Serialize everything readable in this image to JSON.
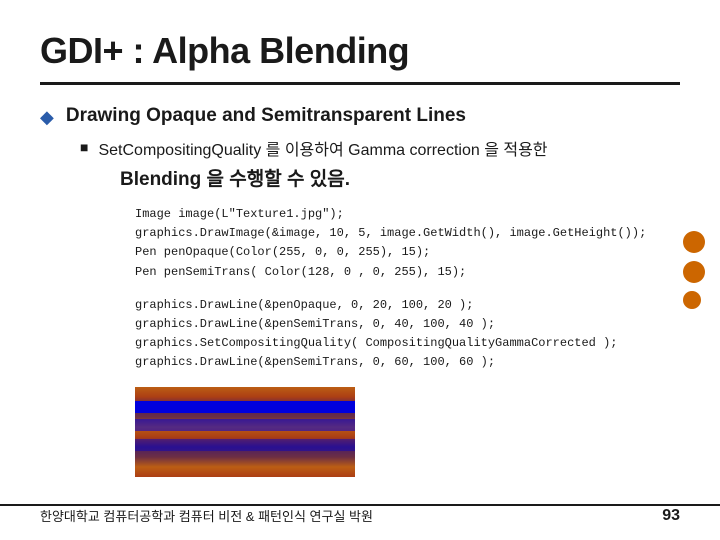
{
  "title": "GDI+ : Alpha Blending",
  "divider": true,
  "main_bullet": {
    "icon": "◆",
    "text": "Drawing Opaque and Semitransparent Lines"
  },
  "sub_bullet": {
    "icon": "■",
    "text_part1": "SetCompositingQuality 를 이용하여 Gamma",
    "text_correction": "correction",
    "text_part2": "을 적용한"
  },
  "blending_text": "Blending 을 수행할 수 있음.",
  "code_block1": [
    "Image image(L\"Texture1.jpg\");",
    "graphics.DrawImage(&image, 10, 5, image.GetWidth(), image.GetHeight());",
    "Pen penOpaque(Color(255, 0, 0, 255), 15);",
    "Pen penSemiTrans( Color(128, 0 , 0, 255), 15);"
  ],
  "code_block2": [
    "graphics.DrawLine(&penOpaque, 0, 20, 100, 20 );",
    "graphics.DrawLine(&penSemiTrans, 0, 40, 100, 40 );",
    "graphics.SetCompositingQuality( CompositingQualityGammaCorrected );",
    "graphics.DrawLine(&penSemiTrans, 0, 60, 100, 60 );"
  ],
  "footer": {
    "left": "한양대학교  컴퓨터공학과  컴퓨터 비전 & 패턴인식 연구실   박원",
    "right": "93"
  },
  "right_circles": [
    {
      "color": "#cc6600"
    },
    {
      "color": "#cc6600"
    },
    {
      "color": "#cc6600"
    }
  ]
}
